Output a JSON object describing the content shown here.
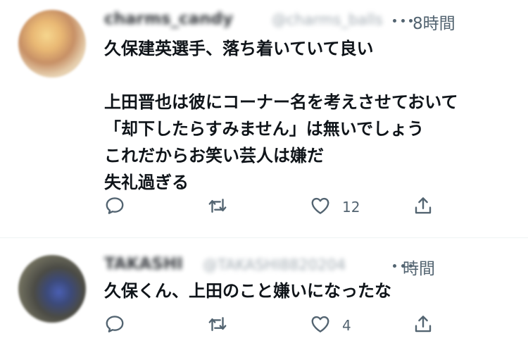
{
  "tweets": [
    {
      "display_name": "charms_candy",
      "handle": "@charms_balls",
      "time": "8時間",
      "text_lines": [
        "久保建英選手、落ち着いていて良い",
        "",
        "上田晋也は彼にコーナー名を考えさせておいて",
        "「却下したらすみません」は無いでしょう",
        "これだからお笑い芸人は嫌だ",
        "失礼過ぎる"
      ],
      "reply_count": "",
      "retweet_count": "",
      "like_count": "12"
    },
    {
      "display_name": "TAKASHI",
      "handle": "@TAKASHI8820204",
      "time": "時間",
      "text_lines": [
        "久保くん、上田のこと嫌いになったな"
      ],
      "reply_count": "",
      "retweet_count": "",
      "like_count": "4"
    }
  ],
  "icons": {
    "more": "more-horizontal-icon",
    "reply": "reply-icon",
    "retweet": "retweet-icon",
    "like": "heart-icon",
    "share": "share-icon"
  },
  "colors": {
    "text_primary": "#0f1419",
    "text_secondary": "#536471",
    "divider": "#eff3f4",
    "background": "#ffffff"
  }
}
